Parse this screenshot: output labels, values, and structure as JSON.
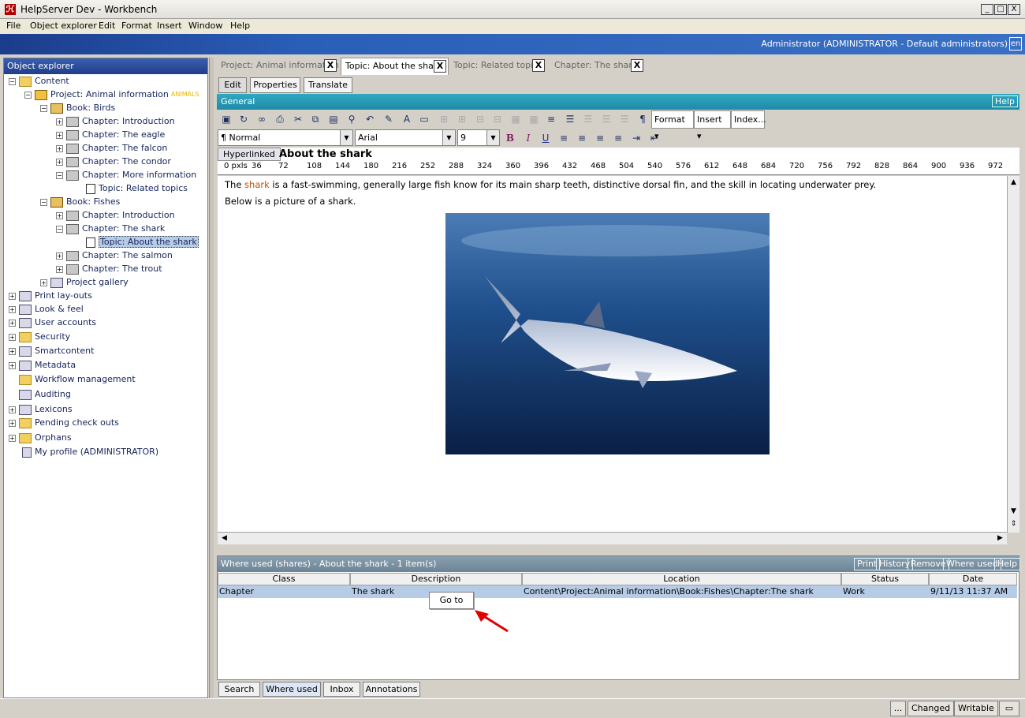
{
  "window": {
    "title": "HelpServer Dev - Workbench",
    "min": "_",
    "max": "□",
    "close": "X"
  },
  "menu": [
    "File",
    "Object explorer",
    "Edit",
    "Format",
    "Insert",
    "Window",
    "Help"
  ],
  "banner": {
    "user": "Administrator (ADMINISTRATOR - Default administrators)",
    "lang": "en"
  },
  "explorer": {
    "title": "Object explorer",
    "project_badge": "ANIMALS",
    "items": [
      {
        "label": "Content"
      },
      {
        "label": "Project: Animal information"
      },
      {
        "label": "Book: Birds"
      },
      {
        "label": "Chapter: Introduction"
      },
      {
        "label": "Chapter: The eagle"
      },
      {
        "label": "Chapter: The falcon"
      },
      {
        "label": "Chapter: The condor"
      },
      {
        "label": "Chapter: More information"
      },
      {
        "label": "Topic: Related topics"
      },
      {
        "label": "Book: Fishes"
      },
      {
        "label": "Chapter: Introduction"
      },
      {
        "label": "Chapter: The shark"
      },
      {
        "label": "Topic: About the shark"
      },
      {
        "label": "Chapter: The salmon"
      },
      {
        "label": "Chapter: The trout"
      },
      {
        "label": "Project gallery"
      },
      {
        "label": "Print lay-outs"
      },
      {
        "label": "Look & feel"
      },
      {
        "label": "User accounts"
      },
      {
        "label": "Security"
      },
      {
        "label": "Smartcontent"
      },
      {
        "label": "Metadata"
      },
      {
        "label": "Workflow management"
      },
      {
        "label": "Auditing"
      },
      {
        "label": "Lexicons"
      },
      {
        "label": "Pending check outs"
      },
      {
        "label": "Orphans"
      },
      {
        "label": "My profile (ADMINISTRATOR)"
      }
    ]
  },
  "doc_tabs": [
    {
      "label": "Project: Animal information",
      "close": "X"
    },
    {
      "label": "Topic: About the shark",
      "close": "X"
    },
    {
      "label": "Topic: Related topics",
      "close": "X"
    },
    {
      "label": "Chapter: The shark",
      "close": "X"
    }
  ],
  "sub_tabs": [
    "Edit",
    "Properties",
    "Translate"
  ],
  "general": {
    "title": "General",
    "help": "Help"
  },
  "toolbar": {
    "format": "Format",
    "insert": "Insert",
    "index": "Index..."
  },
  "formatbar": {
    "style": "Normal",
    "font": "Arial",
    "size": "9",
    "bold": "B",
    "italic": "I",
    "underline": "U"
  },
  "editor": {
    "style_tag": "Hyperlinked",
    "heading": "About the shark",
    "ruler": [
      "0 pxls",
      "36",
      "72",
      "108",
      "144",
      "180",
      "216",
      "252",
      "288",
      "324",
      "360",
      "396",
      "432",
      "468",
      "504",
      "540",
      "576",
      "612",
      "648",
      "684",
      "720",
      "756",
      "792",
      "828",
      "864",
      "900",
      "936",
      "972"
    ],
    "para1_pre": "The ",
    "para1_link": "shark",
    "para1_post": " is a fast-swimming, generally large fish know for its main sharp teeth, distinctive dorsal fin, and the skill in locating underwater prey.",
    "para2": "Below is a picture of a shark."
  },
  "where_used": {
    "title": "Where used (shares) - About the shark - 1 item(s)",
    "buttons": [
      "Print",
      "History",
      "Remove",
      "Where used",
      "Help"
    ],
    "columns": [
      "Class",
      "Description",
      "Location",
      "Status",
      "Date"
    ],
    "rows": [
      {
        "class": "Chapter",
        "description": "The shark",
        "location": "Content\\Project:Animal information\\Book:Fishes\\Chapter:The shark",
        "status": "Work",
        "date": "9/11/13 11:37 AM"
      }
    ],
    "context_menu": "Go to"
  },
  "bottom_tabs": [
    "Search",
    "Where used",
    "Inbox",
    "Annotations"
  ],
  "status": {
    "dots": "...",
    "changed": "Changed",
    "writable": "Writable"
  }
}
